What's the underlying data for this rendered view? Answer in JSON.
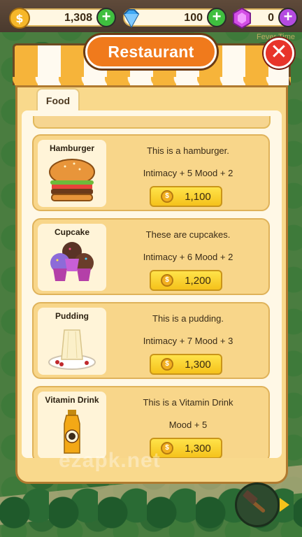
{
  "resources": {
    "coins": "1,308",
    "gems": "100",
    "crystals": "0"
  },
  "fever_label": "Fever Time",
  "dialog": {
    "title": "Restaurant",
    "close_icon": "close-icon",
    "tabs": [
      {
        "label": "Food"
      }
    ]
  },
  "items": [
    {
      "name": "Hamburger",
      "description": "This is a hamburger.",
      "stats": "Intimacy + 5 Mood + 2",
      "price": "1,100",
      "icon": "hamburger-icon"
    },
    {
      "name": "Cupcake",
      "description": "These are cupcakes.",
      "stats": "Intimacy + 6 Mood + 2",
      "price": "1,200",
      "icon": "cupcake-icon"
    },
    {
      "name": "Pudding",
      "description": "This is a pudding.",
      "stats": "Intimacy + 7 Mood + 3",
      "price": "1,300",
      "icon": "pudding-icon"
    },
    {
      "name": "Vitamin Drink",
      "description": "This is a Vitamin Drink",
      "stats": "Mood + 5",
      "price": "1,300",
      "icon": "vitamin-drink-icon"
    }
  ],
  "watermark": "ezapk.net",
  "colors": {
    "accent_orange": "#f07a1c",
    "panel": "#f9d98c",
    "buy_button": "#f5c21b",
    "close_red": "#e8342a"
  }
}
